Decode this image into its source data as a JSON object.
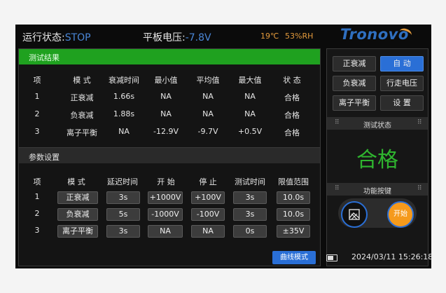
{
  "status": {
    "run_label": "运行状态:",
    "run_value": "STOP",
    "voltage_label": "平板电压:",
    "voltage_value": "-7.8V",
    "temp": "19℃",
    "humidity": "53%RH"
  },
  "brand": "Tronovo",
  "results": {
    "header": "测试结果",
    "columns": [
      "项",
      "模 式",
      "衰减时间",
      "最小值",
      "平均值",
      "最大值",
      "状 态"
    ],
    "rows": [
      {
        "idx": "1",
        "mode": "正衰减",
        "decay": "1.66s",
        "min": "NA",
        "avg": "NA",
        "max": "NA",
        "status": "合格"
      },
      {
        "idx": "2",
        "mode": "负衰减",
        "decay": "1.88s",
        "min": "NA",
        "avg": "NA",
        "max": "NA",
        "status": "合格"
      },
      {
        "idx": "3",
        "mode": "离子平衡",
        "decay": "NA",
        "min": "-12.9V",
        "avg": "-9.7V",
        "max": "+0.5V",
        "status": "合格"
      }
    ]
  },
  "params": {
    "header": "参数设置",
    "columns": [
      "项",
      "模 式",
      "延迟时间",
      "开 始",
      "停 止",
      "测试时间",
      "限值范围"
    ],
    "rows": [
      {
        "idx": "1",
        "mode": "正衰减",
        "delay": "3s",
        "start": "+1000V",
        "stop": "+100V",
        "test_time": "3s",
        "limit": "10.0s"
      },
      {
        "idx": "2",
        "mode": "负衰减",
        "delay": "5s",
        "start": "-1000V",
        "stop": "-100V",
        "test_time": "3s",
        "limit": "10.0s"
      },
      {
        "idx": "3",
        "mode": "离子平衡",
        "delay": "3s",
        "start": "NA",
        "stop": "NA",
        "test_time": "0s",
        "limit": "±35V"
      }
    ]
  },
  "side": {
    "btn_pos_decay": "正衰减",
    "btn_auto": "自 动",
    "btn_neg_decay": "负衰减",
    "btn_walk_voltage": "行走电压",
    "btn_ion_balance": "离子平衡",
    "btn_settings": "设 置",
    "test_status_label": "测试状态",
    "test_status_value": "合格",
    "function_label": "功能按键",
    "start_label": "开始",
    "grip": "⠿"
  },
  "footer": {
    "mode_button": "曲线模式",
    "datetime": "2024/03/11 15:26:18"
  },
  "colors": {
    "accent_blue": "#2a6fd6",
    "pass_green": "#2fb52f",
    "start_orange": "#f59a1c"
  }
}
